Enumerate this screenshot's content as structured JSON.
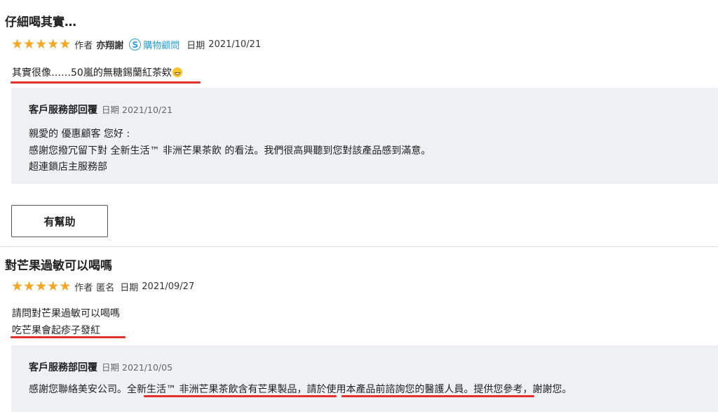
{
  "reviews": [
    {
      "title": "仔細喝其實…",
      "rating": 5,
      "author_label": "作者",
      "author": "亦翔謝",
      "badge_label": "購物顧問",
      "date_label": "日期",
      "date": "2021/10/21",
      "body": [
        "其實很像……50嵐的無糖錫蘭紅茶欸"
      ],
      "emoji": "grinning-face-icon",
      "reply": {
        "title": "客戶服務部回覆",
        "date_label": "日期",
        "date": "2021/10/21",
        "lines": [
          "親愛的 優惠顧客 您好 :",
          "感謝您撥冗留下對 全新生活™ 非洲芒果茶飲 的看法。我們很高興聽到您對該產品感到滿意。",
          "超連鎖店主服務部"
        ]
      },
      "helpful_label": "有幫助"
    },
    {
      "title": "對芒果過敏可以喝嗎",
      "rating": 5,
      "author_label": "作者",
      "author": "匿名",
      "date_label": "日期",
      "date": "2021/09/27",
      "body": [
        "請問對芒果過敏可以喝嗎",
        "吃芒果會起疹子發紅"
      ],
      "reply": {
        "title": "客戶服務部回覆",
        "date_label": "日期",
        "date": "2021/10/05",
        "lines": [
          "感謝您聯絡美安公司。全新生活™ 非洲芒果茶飲含有芒果製品，請於使用本產品前諮詢您的醫護人員。提供您參考，謝謝您。"
        ]
      }
    }
  ],
  "colors": {
    "star": "#f5a623",
    "badge": "#2a9fd6",
    "underline": "#e4312b",
    "reply_bg": "#eef0f3"
  }
}
